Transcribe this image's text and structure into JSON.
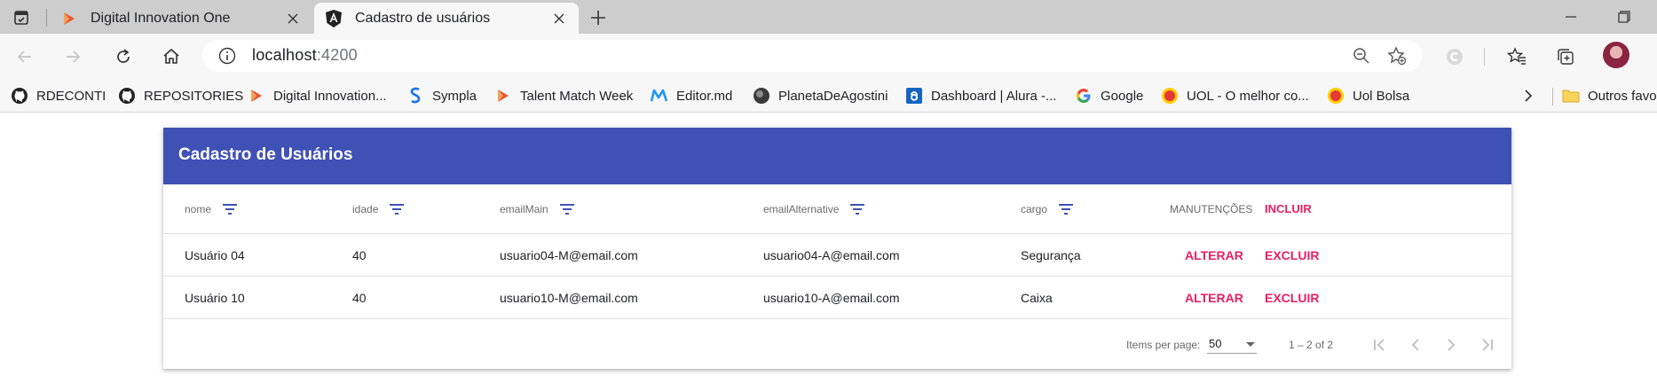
{
  "browser": {
    "tabs": [
      {
        "title": "Digital Innovation One",
        "icon": "dio-icon",
        "active": false
      },
      {
        "title": "Cadastro de usuários",
        "icon": "angular-icon",
        "active": true
      }
    ],
    "address": {
      "host": "localhost",
      "port": ":4200"
    },
    "bookmarks": [
      {
        "label": "RDECONTI",
        "icon": "github-icon"
      },
      {
        "label": "REPOSITORIES",
        "icon": "github-icon"
      },
      {
        "label": "Digital Innovation...",
        "icon": "dio-icon"
      },
      {
        "label": "Sympla",
        "icon": "sympla-icon"
      },
      {
        "label": "Talent Match Week",
        "icon": "dio-icon"
      },
      {
        "label": "Editor.md",
        "icon": "editor-md-icon"
      },
      {
        "label": "PlanetaDeAgostini",
        "icon": "planet-icon"
      },
      {
        "label": "Dashboard | Alura -...",
        "icon": "alura-icon"
      },
      {
        "label": "Google",
        "icon": "google-icon"
      },
      {
        "label": "UOL - O melhor co...",
        "icon": "uol-icon"
      },
      {
        "label": "Uol Bolsa",
        "icon": "uol-icon"
      }
    ],
    "other_favorites": "Outros favo"
  },
  "app": {
    "title": "Cadastro de Usuários",
    "columns": {
      "nome": "nome",
      "idade": "idade",
      "emailMain": "emailMain",
      "emailAlternative": "emailAlternative",
      "cargo": "cargo",
      "manutencoes": "MANUTENÇÕES",
      "incluir": "INCLUIR"
    },
    "rows": [
      {
        "nome": "Usuário 04",
        "idade": "40",
        "emailMain": "usuario04-M@email.com",
        "emailAlternative": "usuario04-A@email.com",
        "cargo": "Segurança",
        "alterar": "ALTERAR",
        "excluir": "EXCLUIR"
      },
      {
        "nome": "Usuário 10",
        "idade": "40",
        "emailMain": "usuario10-M@email.com",
        "emailAlternative": "usuario10-A@email.com",
        "cargo": "Caixa",
        "alterar": "ALTERAR",
        "excluir": "EXCLUIR"
      }
    ],
    "paginator": {
      "items_per_page_label": "Items per page:",
      "page_size": "50",
      "range": "1 – 2 of 2"
    }
  },
  "colors": {
    "header": "#3f51b5",
    "accent": "#e91e63"
  }
}
